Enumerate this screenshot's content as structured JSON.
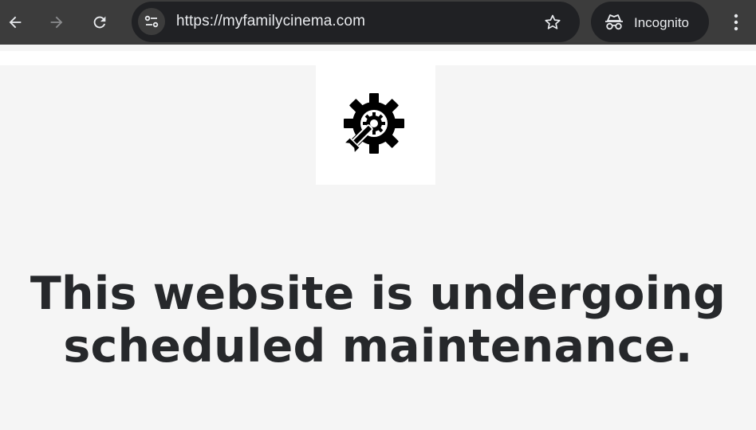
{
  "browser": {
    "url": "https://myfamilycinema.com",
    "incognito_label": "Incognito",
    "icons": {
      "back": "back-arrow-icon",
      "forward": "forward-arrow-icon",
      "reload": "reload-icon",
      "site_info": "tune-icon",
      "bookmark": "star-icon",
      "incognito": "incognito-icon",
      "menu": "kebab-menu-icon"
    }
  },
  "page": {
    "logo_icon": "gear-wrench-icon",
    "heading_line1": "This website is undergoing",
    "heading_line2": "scheduled maintenance."
  },
  "colors": {
    "toolbar_bg": "#3c3c3c",
    "omnibox_bg": "#202124",
    "page_bg": "#f5f5f5",
    "heading_text": "#26282b"
  }
}
